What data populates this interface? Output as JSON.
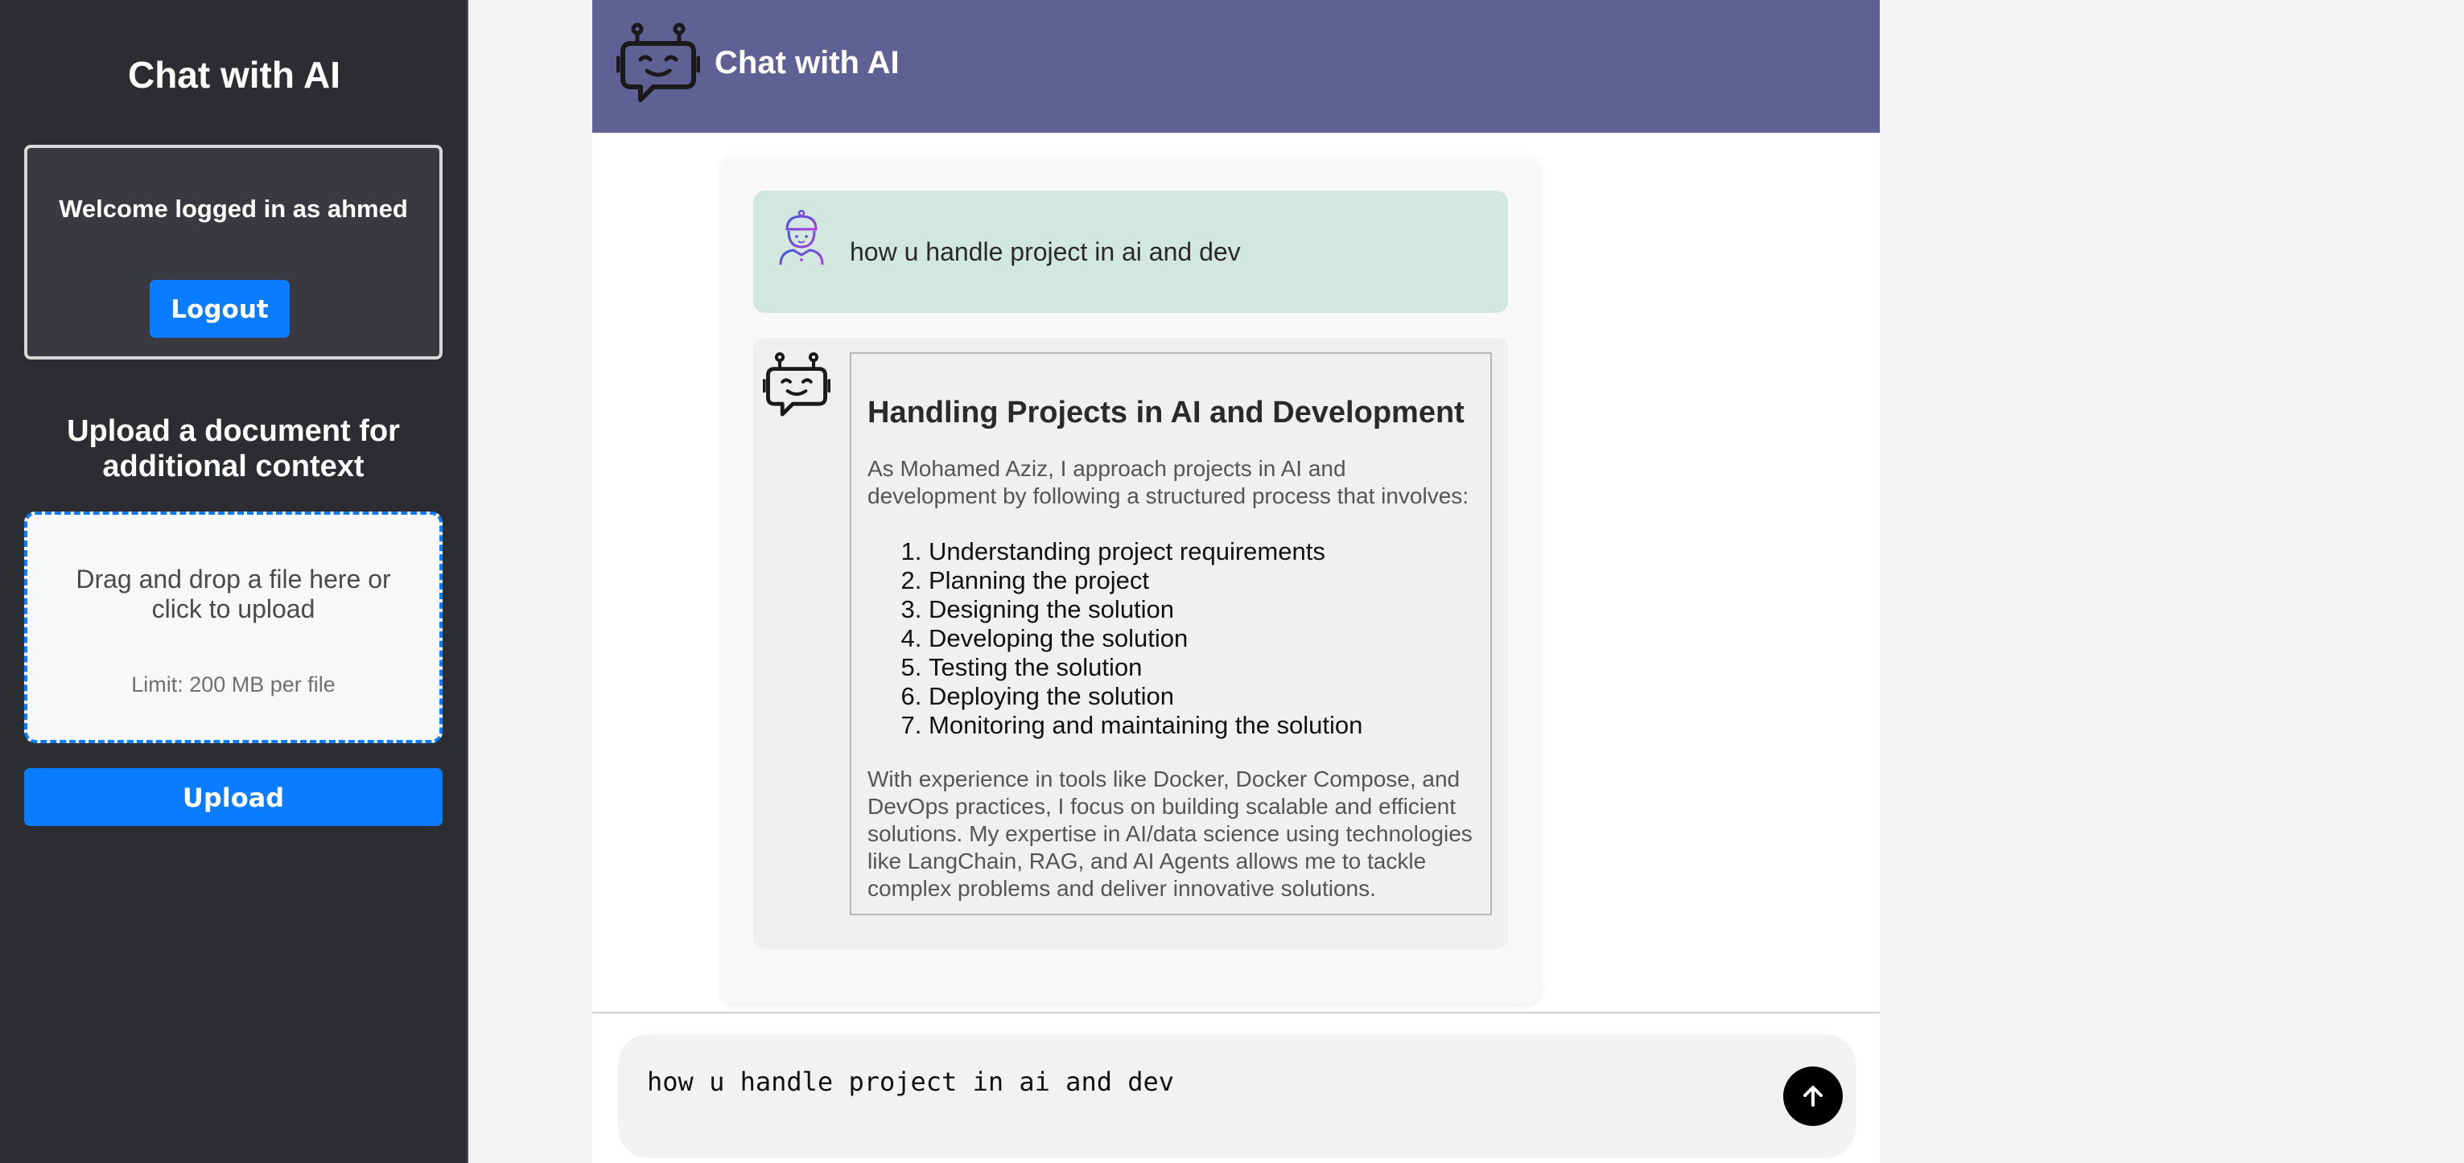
{
  "sidebar": {
    "title": "Chat with AI",
    "welcome_text": "Welcome logged in as ahmed",
    "logout_label": "Logout",
    "upload_heading": "Upload a document for additional context",
    "dropzone_text": "Drag and drop a file here or click to upload",
    "dropzone_limit": "Limit: 200 MB per file",
    "upload_label": "Upload"
  },
  "chat": {
    "header_title": "Chat with AI",
    "header_icon": "robot-icon",
    "messages": [
      {
        "role": "user",
        "avatar": "user-avatar-icon",
        "text": "how u handle project in ai and dev"
      },
      {
        "role": "assistant",
        "avatar": "robot-icon",
        "heading": "Handling Projects in AI and Development",
        "intro": "As Mohamed Aziz, I approach projects in AI and development by following a structured process that involves:",
        "steps": [
          "Understanding project requirements",
          "Planning the project",
          "Designing the solution",
          "Developing the solution",
          "Testing the solution",
          "Deploying the solution",
          "Monitoring and maintaining the solution"
        ],
        "outro": "With experience in tools like Docker, Docker Compose, and DevOps practices, I focus on building scalable and efficient solutions. My expertise in AI/data science using technologies like LangChain, RAG, and AI Agents allows me to tackle complex problems and deliver innovative solutions."
      }
    ],
    "input_value": "how u handle project in ai and dev",
    "send_icon": "arrow-up-icon"
  },
  "colors": {
    "sidebar_bg": "#2b2d31",
    "header_bg": "#5f6094",
    "accent": "#0a7cff",
    "user_bubble": "#d2e8df",
    "bot_bubble": "#efefef"
  }
}
